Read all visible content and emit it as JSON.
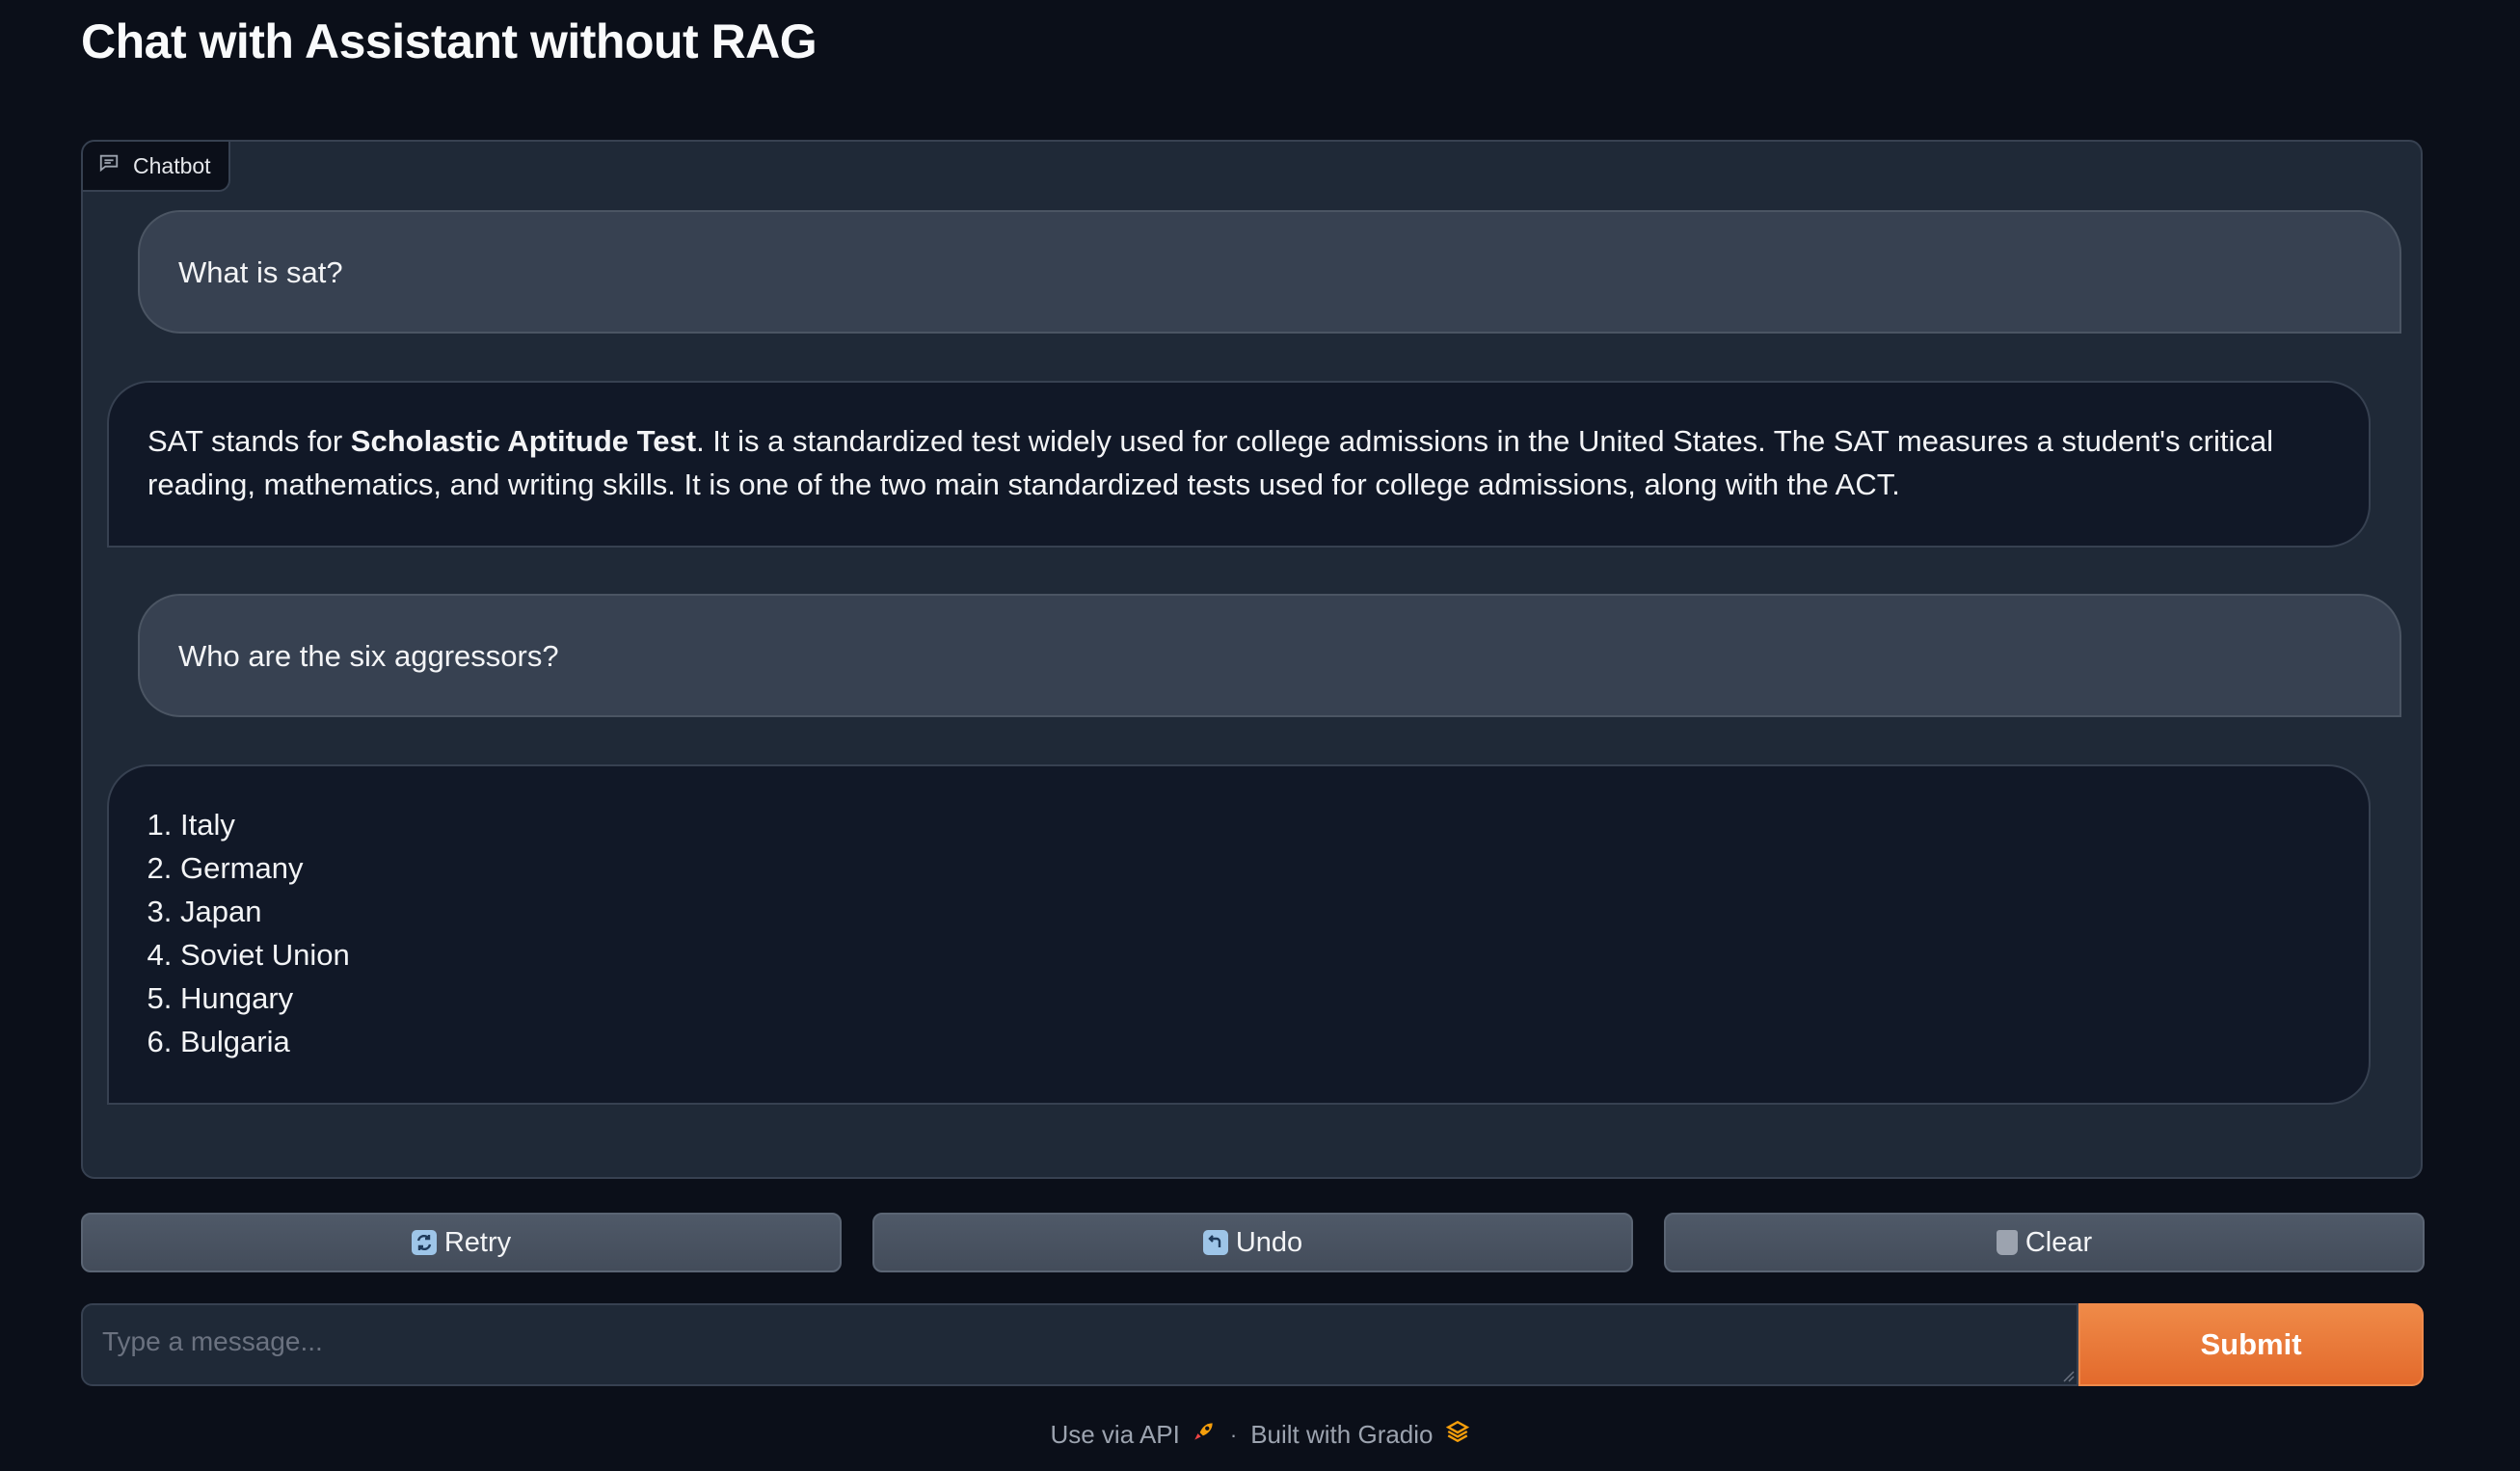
{
  "page": {
    "title": "Chat with Assistant without RAG"
  },
  "chatbot": {
    "label": "Chatbot",
    "messages": [
      {
        "role": "user",
        "text": "What is sat?"
      },
      {
        "role": "assistant",
        "prefix": "SAT stands for ",
        "bold": "Scholastic Aptitude Test",
        "suffix": ". It is a standardized test widely used for college admissions in the United States. The SAT measures a student's critical reading, mathematics, and writing skills. It is one of the two main standardized tests used for college admissions, along with the ACT."
      },
      {
        "role": "user",
        "text": "Who are the six aggressors?"
      },
      {
        "role": "assistant",
        "list": [
          "Italy",
          "Germany",
          "Japan",
          "Soviet Union",
          "Hungary",
          "Bulgaria"
        ]
      }
    ]
  },
  "buttons": {
    "retry": "Retry",
    "undo": "Undo",
    "clear": "Clear"
  },
  "input": {
    "placeholder": "Type a message...",
    "value": ""
  },
  "submit": {
    "label": "Submit"
  },
  "footer": {
    "api_link": "Use via API",
    "separator": "·",
    "built_with": "Built with Gradio"
  },
  "colors": {
    "background": "#0b0f19",
    "panel": "#1f2937",
    "user_bubble": "#374151",
    "bot_bubble": "#111827",
    "accent": "#e8732f"
  },
  "icons": {
    "chatbot": "chat-bubble-icon",
    "retry": "refresh-icon",
    "undo": "undo-arrow-icon",
    "clear": "trash-icon",
    "api": "rocket-icon",
    "gradio": "gradio-logo-icon"
  }
}
